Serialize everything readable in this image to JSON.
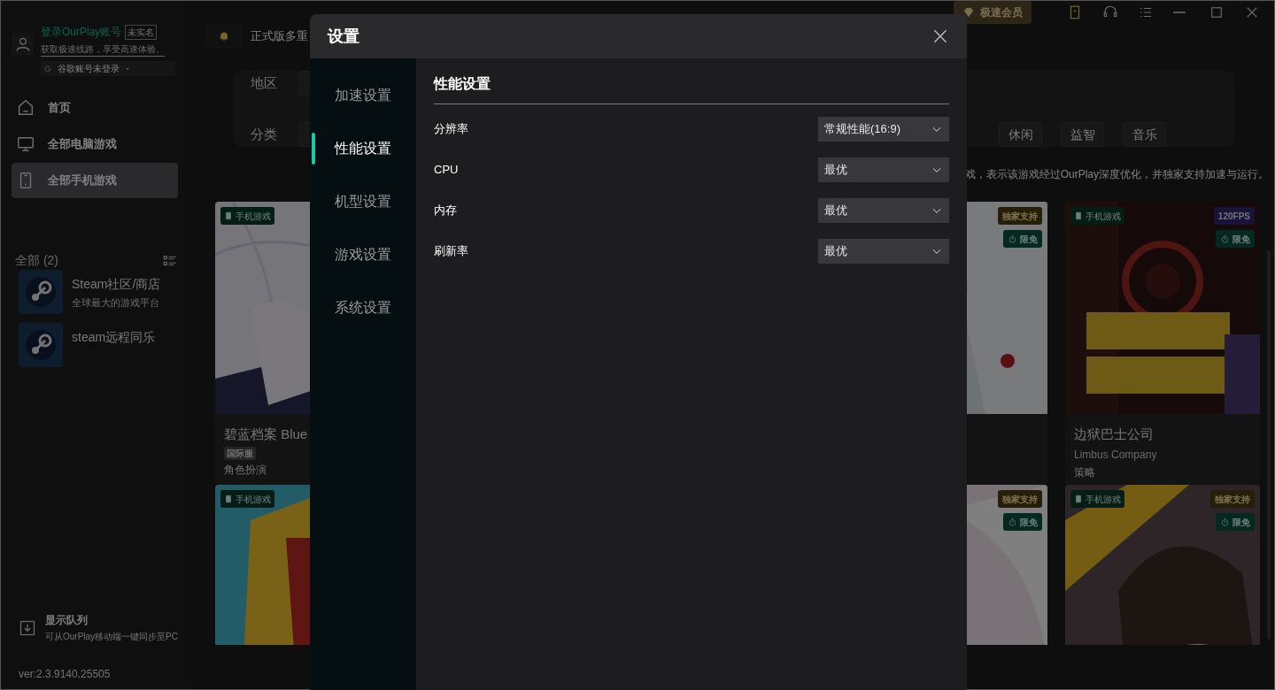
{
  "sidebar": {
    "account": {
      "title": "登录OurPlay账号",
      "badge": "未实名",
      "subtitle": "获取极速线路，享受高速体验。",
      "google": "谷歌账号未登录"
    },
    "nav": [
      {
        "label": "首页",
        "selected": false
      },
      {
        "label": "全部电脑游戏",
        "selected": false
      },
      {
        "label": "全部手机游戏",
        "selected": true
      }
    ],
    "library": {
      "title": "全部 (2)",
      "items": [
        {
          "name": "Steam社区/商店",
          "subtitle": "全球最大的游戏平台"
        },
        {
          "name": "steam远程同乐"
        }
      ]
    },
    "queue": {
      "title": "显示队列",
      "subtitle": "可从OurPlay移动端一键同步至PC"
    },
    "version": "ver:2.3.9140.25505"
  },
  "topbar": {
    "vip_button": "极速会员",
    "notice": "正式版多重"
  },
  "filters": {
    "rows": [
      {
        "label": "地区"
      },
      {
        "label": "分类",
        "chips": [
          "休闲",
          "益智",
          "音乐"
        ]
      }
    ]
  },
  "hint": "戏，表示该游戏经过OurPlay深度优化，并独家支持加速与运行。",
  "card_rows": [
    {
      "cards": [
        {
          "platform": "手机游戏",
          "title": "碧蓝档案 Blue",
          "region": "国际服",
          "genre": "角色扮演"
        },
        {
          "badges": [
            {
              "text": "独家支持",
              "kind": "exclusive"
            },
            {
              "text": "限免",
              "kind": "free"
            }
          ]
        },
        {
          "platform": "手机游戏",
          "badges": [
            {
              "text": "120FPS",
              "kind": "fps"
            },
            {
              "text": "限免",
              "kind": "free"
            }
          ],
          "title": "边狱巴士公司",
          "subtitle": "Limbus Company",
          "genre": "策略"
        }
      ]
    },
    {
      "cards": [
        {
          "platform": "手机游戏"
        },
        {
          "badges": [
            {
              "text": "独家支持",
              "kind": "exclusive"
            },
            {
              "text": "限免",
              "kind": "free"
            }
          ]
        },
        {
          "platform": "手机游戏",
          "badges": [
            {
              "text": "独家支持",
              "kind": "exclusive"
            },
            {
              "text": "限免",
              "kind": "free"
            }
          ]
        }
      ]
    }
  ],
  "dialog": {
    "title": "设置",
    "tabs": [
      {
        "label": "加速设置",
        "selected": false
      },
      {
        "label": "性能设置",
        "selected": true
      },
      {
        "label": "机型设置",
        "selected": false
      },
      {
        "label": "游戏设置",
        "selected": false
      },
      {
        "label": "系统设置",
        "selected": false
      }
    ],
    "section": "性能设置",
    "settings": [
      {
        "label": "分辨率",
        "value": "常规性能(16:9)"
      },
      {
        "label": "CPU",
        "value": "最优"
      },
      {
        "label": "内存",
        "value": "最优"
      },
      {
        "label": "刷新率",
        "value": "最优"
      }
    ]
  }
}
